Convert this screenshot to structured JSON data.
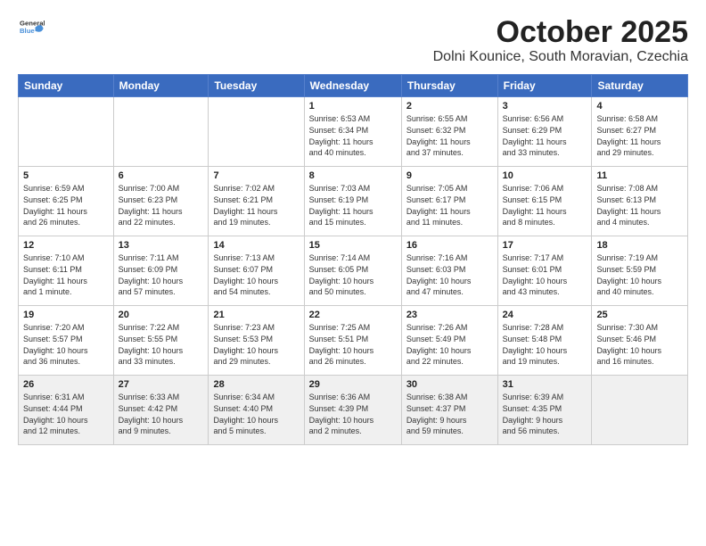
{
  "header": {
    "logo_general": "General",
    "logo_blue": "Blue",
    "month": "October 2025",
    "location": "Dolni Kounice, South Moravian, Czechia"
  },
  "weekdays": [
    "Sunday",
    "Monday",
    "Tuesday",
    "Wednesday",
    "Thursday",
    "Friday",
    "Saturday"
  ],
  "weeks": [
    [
      {
        "day": "",
        "content": ""
      },
      {
        "day": "",
        "content": ""
      },
      {
        "day": "",
        "content": ""
      },
      {
        "day": "1",
        "content": "Sunrise: 6:53 AM\nSunset: 6:34 PM\nDaylight: 11 hours\nand 40 minutes."
      },
      {
        "day": "2",
        "content": "Sunrise: 6:55 AM\nSunset: 6:32 PM\nDaylight: 11 hours\nand 37 minutes."
      },
      {
        "day": "3",
        "content": "Sunrise: 6:56 AM\nSunset: 6:29 PM\nDaylight: 11 hours\nand 33 minutes."
      },
      {
        "day": "4",
        "content": "Sunrise: 6:58 AM\nSunset: 6:27 PM\nDaylight: 11 hours\nand 29 minutes."
      }
    ],
    [
      {
        "day": "5",
        "content": "Sunrise: 6:59 AM\nSunset: 6:25 PM\nDaylight: 11 hours\nand 26 minutes."
      },
      {
        "day": "6",
        "content": "Sunrise: 7:00 AM\nSunset: 6:23 PM\nDaylight: 11 hours\nand 22 minutes."
      },
      {
        "day": "7",
        "content": "Sunrise: 7:02 AM\nSunset: 6:21 PM\nDaylight: 11 hours\nand 19 minutes."
      },
      {
        "day": "8",
        "content": "Sunrise: 7:03 AM\nSunset: 6:19 PM\nDaylight: 11 hours\nand 15 minutes."
      },
      {
        "day": "9",
        "content": "Sunrise: 7:05 AM\nSunset: 6:17 PM\nDaylight: 11 hours\nand 11 minutes."
      },
      {
        "day": "10",
        "content": "Sunrise: 7:06 AM\nSunset: 6:15 PM\nDaylight: 11 hours\nand 8 minutes."
      },
      {
        "day": "11",
        "content": "Sunrise: 7:08 AM\nSunset: 6:13 PM\nDaylight: 11 hours\nand 4 minutes."
      }
    ],
    [
      {
        "day": "12",
        "content": "Sunrise: 7:10 AM\nSunset: 6:11 PM\nDaylight: 11 hours\nand 1 minute."
      },
      {
        "day": "13",
        "content": "Sunrise: 7:11 AM\nSunset: 6:09 PM\nDaylight: 10 hours\nand 57 minutes."
      },
      {
        "day": "14",
        "content": "Sunrise: 7:13 AM\nSunset: 6:07 PM\nDaylight: 10 hours\nand 54 minutes."
      },
      {
        "day": "15",
        "content": "Sunrise: 7:14 AM\nSunset: 6:05 PM\nDaylight: 10 hours\nand 50 minutes."
      },
      {
        "day": "16",
        "content": "Sunrise: 7:16 AM\nSunset: 6:03 PM\nDaylight: 10 hours\nand 47 minutes."
      },
      {
        "day": "17",
        "content": "Sunrise: 7:17 AM\nSunset: 6:01 PM\nDaylight: 10 hours\nand 43 minutes."
      },
      {
        "day": "18",
        "content": "Sunrise: 7:19 AM\nSunset: 5:59 PM\nDaylight: 10 hours\nand 40 minutes."
      }
    ],
    [
      {
        "day": "19",
        "content": "Sunrise: 7:20 AM\nSunset: 5:57 PM\nDaylight: 10 hours\nand 36 minutes."
      },
      {
        "day": "20",
        "content": "Sunrise: 7:22 AM\nSunset: 5:55 PM\nDaylight: 10 hours\nand 33 minutes."
      },
      {
        "day": "21",
        "content": "Sunrise: 7:23 AM\nSunset: 5:53 PM\nDaylight: 10 hours\nand 29 minutes."
      },
      {
        "day": "22",
        "content": "Sunrise: 7:25 AM\nSunset: 5:51 PM\nDaylight: 10 hours\nand 26 minutes."
      },
      {
        "day": "23",
        "content": "Sunrise: 7:26 AM\nSunset: 5:49 PM\nDaylight: 10 hours\nand 22 minutes."
      },
      {
        "day": "24",
        "content": "Sunrise: 7:28 AM\nSunset: 5:48 PM\nDaylight: 10 hours\nand 19 minutes."
      },
      {
        "day": "25",
        "content": "Sunrise: 7:30 AM\nSunset: 5:46 PM\nDaylight: 10 hours\nand 16 minutes."
      }
    ],
    [
      {
        "day": "26",
        "content": "Sunrise: 6:31 AM\nSunset: 4:44 PM\nDaylight: 10 hours\nand 12 minutes."
      },
      {
        "day": "27",
        "content": "Sunrise: 6:33 AM\nSunset: 4:42 PM\nDaylight: 10 hours\nand 9 minutes."
      },
      {
        "day": "28",
        "content": "Sunrise: 6:34 AM\nSunset: 4:40 PM\nDaylight: 10 hours\nand 5 minutes."
      },
      {
        "day": "29",
        "content": "Sunrise: 6:36 AM\nSunset: 4:39 PM\nDaylight: 10 hours\nand 2 minutes."
      },
      {
        "day": "30",
        "content": "Sunrise: 6:38 AM\nSunset: 4:37 PM\nDaylight: 9 hours\nand 59 minutes."
      },
      {
        "day": "31",
        "content": "Sunrise: 6:39 AM\nSunset: 4:35 PM\nDaylight: 9 hours\nand 56 minutes."
      },
      {
        "day": "",
        "content": ""
      }
    ]
  ]
}
